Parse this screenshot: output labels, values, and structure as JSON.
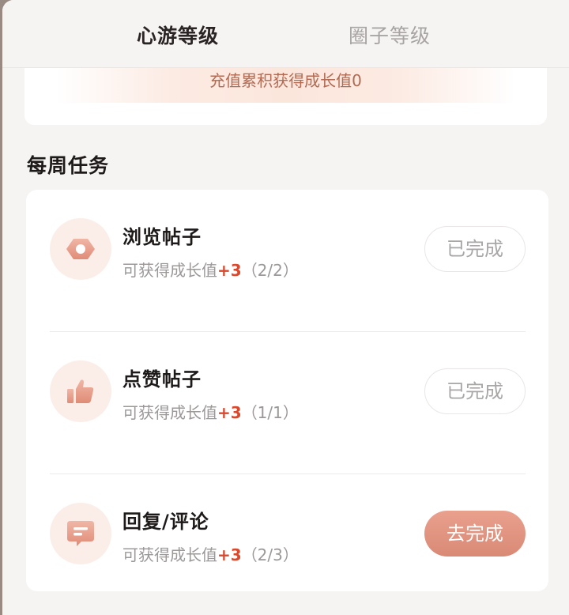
{
  "tabs": [
    {
      "label": "心游等级",
      "active": true
    },
    {
      "label": "圈子等级",
      "active": false
    }
  ],
  "growth_note": "充值累积获得成长值0",
  "section_title": "每周任务",
  "tasks": [
    {
      "title": "浏览帖子",
      "reward_prefix": "可获得成长值",
      "reward_value": "+3",
      "progress": "（2/2）",
      "button": "已完成",
      "status": "done",
      "icon": "eye-icon"
    },
    {
      "title": "点赞帖子",
      "reward_prefix": "可获得成长值",
      "reward_value": "+3",
      "progress": "（1/1）",
      "button": "已完成",
      "status": "done",
      "icon": "thumbs-up-icon"
    },
    {
      "title": "回复/评论",
      "reward_prefix": "可获得成长值",
      "reward_value": "+3",
      "progress": "（2/3）",
      "button": "去完成",
      "status": "todo",
      "icon": "comment-icon"
    }
  ],
  "colors": {
    "accent": "#d9492e",
    "button_gradient_top": "#e9a08d",
    "icon_bg": "#fbeee8",
    "icon_fg": "#e79e8b"
  }
}
